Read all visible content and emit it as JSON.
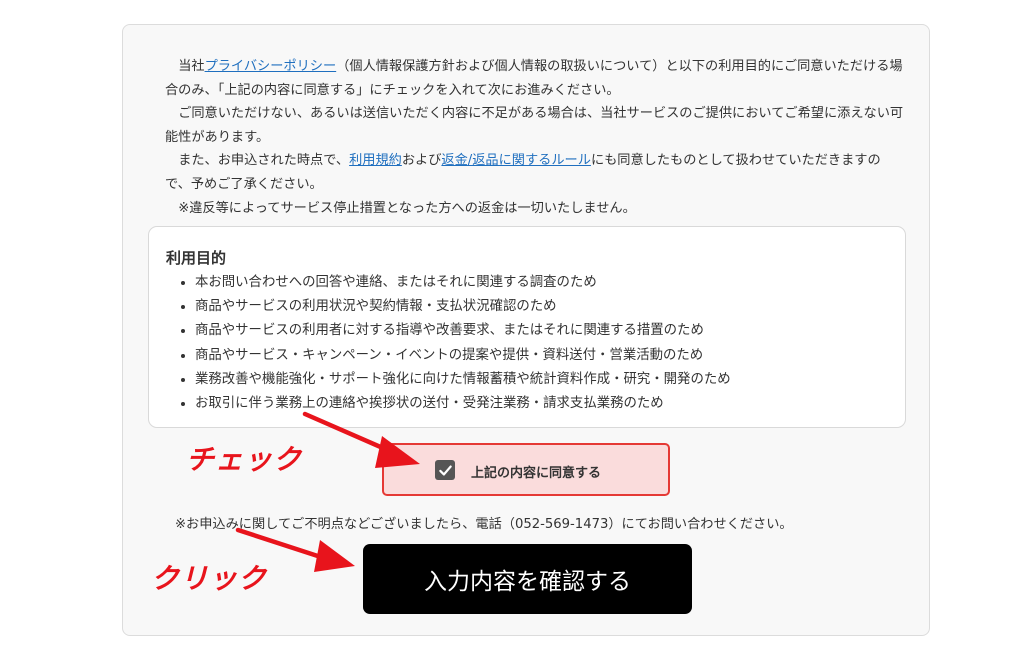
{
  "intro": {
    "p1_before": "当社",
    "privacy_link": "プライバシーポリシー",
    "p1_after": "（個人情報保護方針および個人情報の取扱いについて）と以下の利用目的にご同意いただける場合のみ、「上記の内容に同意する」にチェックを入れて次にお進みください。",
    "p2": "ご同意いただけない、あるいは送信いただく内容に不足がある場合は、当社サービスのご提供においてご希望に添えない可能性があります。",
    "p3_before": "また、お申込された時点で、",
    "terms_link": "利用規約",
    "p3_mid": "および",
    "refund_link": "返金/返品に関するルール",
    "p3_after": "にも同意したものとして扱わせていただきますので、予めご了承ください。",
    "p4": "※違反等によってサービス停止措置となった方への返金は一切いたしません。"
  },
  "purpose": {
    "title": "利用目的",
    "items": [
      "本お問い合わせへの回答や連絡、またはそれに関連する調査のため",
      "商品やサービスの利用状況や契約情報・支払状況確認のため",
      "商品やサービスの利用者に対する指導や改善要求、またはそれに関連する措置のため",
      "商品やサービス・キャンペーン・イベントの提案や提供・資料送付・営業活動のため",
      "業務改善や機能強化・サポート強化に向けた情報蓄積や統計資料作成・研究・開発のため",
      "お取引に伴う業務上の連絡や挨拶状の送付・受発注業務・請求支払業務のため"
    ]
  },
  "consent": {
    "label": "上記の内容に同意する",
    "checked": true
  },
  "phone_note": "※お申込みに関してご不明点などございましたら、電話（052-569-1473）にてお問い合わせください。",
  "confirm_button": "入力内容を確認する",
  "annotations": {
    "check": "チェック",
    "click": "クリック",
    "color": "#e8141c"
  }
}
